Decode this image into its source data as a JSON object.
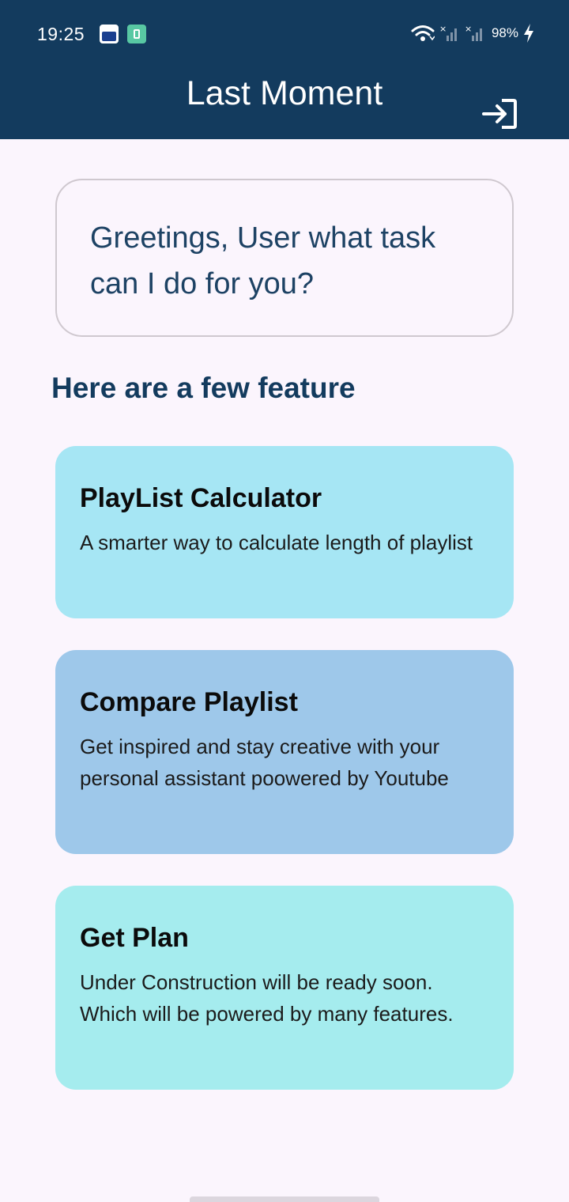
{
  "status_bar": {
    "time": "19:25",
    "battery": "98%",
    "notification_icons": [
      "shopping-cart-icon",
      "app-notification-icon"
    ],
    "system_icons": [
      "wifi-icon",
      "signal-icon",
      "signal-icon",
      "charging-icon"
    ]
  },
  "app_bar": {
    "title": "Last Moment",
    "action_icon": "logout-icon",
    "background_color": "#133b5e"
  },
  "greeting": {
    "text": "Greetings, User what task can I do for you?"
  },
  "section_title": "Here are a few feature",
  "features": [
    {
      "title": "PlayList Calculator",
      "description": "A smarter way to calculate length of playlist",
      "color": "#a6e6f4"
    },
    {
      "title": "Compare Playlist",
      "description": "Get inspired and stay creative with your personal assistant poowered by Youtube",
      "color": "#9ec8ea"
    },
    {
      "title": "Get Plan",
      "description": "Under Construction will be ready soon. Which will be powered by many features.",
      "color": "#a5ecee"
    }
  ]
}
